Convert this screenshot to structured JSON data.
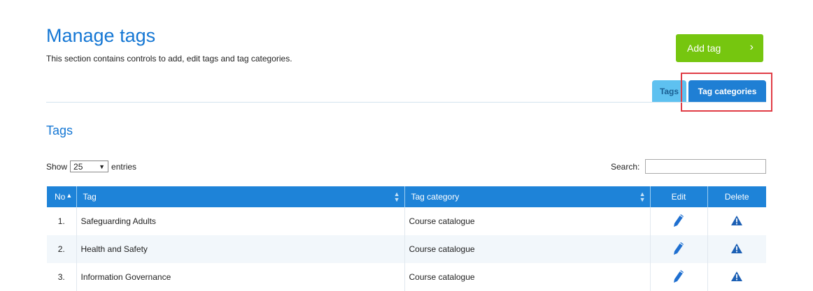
{
  "page": {
    "title": "Manage tags",
    "subtitle": "This section contains controls to add, edit tags and tag categories."
  },
  "actions": {
    "add_tag_label": "Add tag"
  },
  "tabs": [
    {
      "label": "Tags",
      "active": false
    },
    {
      "label": "Tag categories",
      "active": true
    }
  ],
  "section": {
    "title": "Tags"
  },
  "table_controls": {
    "show_label": "Show",
    "entries_value": "25",
    "entries_label": "entries",
    "search_label": "Search:",
    "search_value": ""
  },
  "table": {
    "columns": [
      "No",
      "Tag",
      "Tag category",
      "Edit",
      "Delete"
    ],
    "rows": [
      {
        "no": "1.",
        "tag": "Safeguarding Adults",
        "category": "Course catalogue"
      },
      {
        "no": "2.",
        "tag": "Health and Safety",
        "category": "Course catalogue"
      },
      {
        "no": "3.",
        "tag": "Information Governance",
        "category": "Course catalogue"
      }
    ]
  },
  "colors": {
    "accent": "#1577d4",
    "add_button": "#76c60f",
    "header_bg": "#1e83d8",
    "highlight": "#e03c45"
  },
  "icons": {
    "edit": "pencil-icon",
    "delete": "warning-triangle-icon",
    "add": "chevron-right-icon"
  }
}
